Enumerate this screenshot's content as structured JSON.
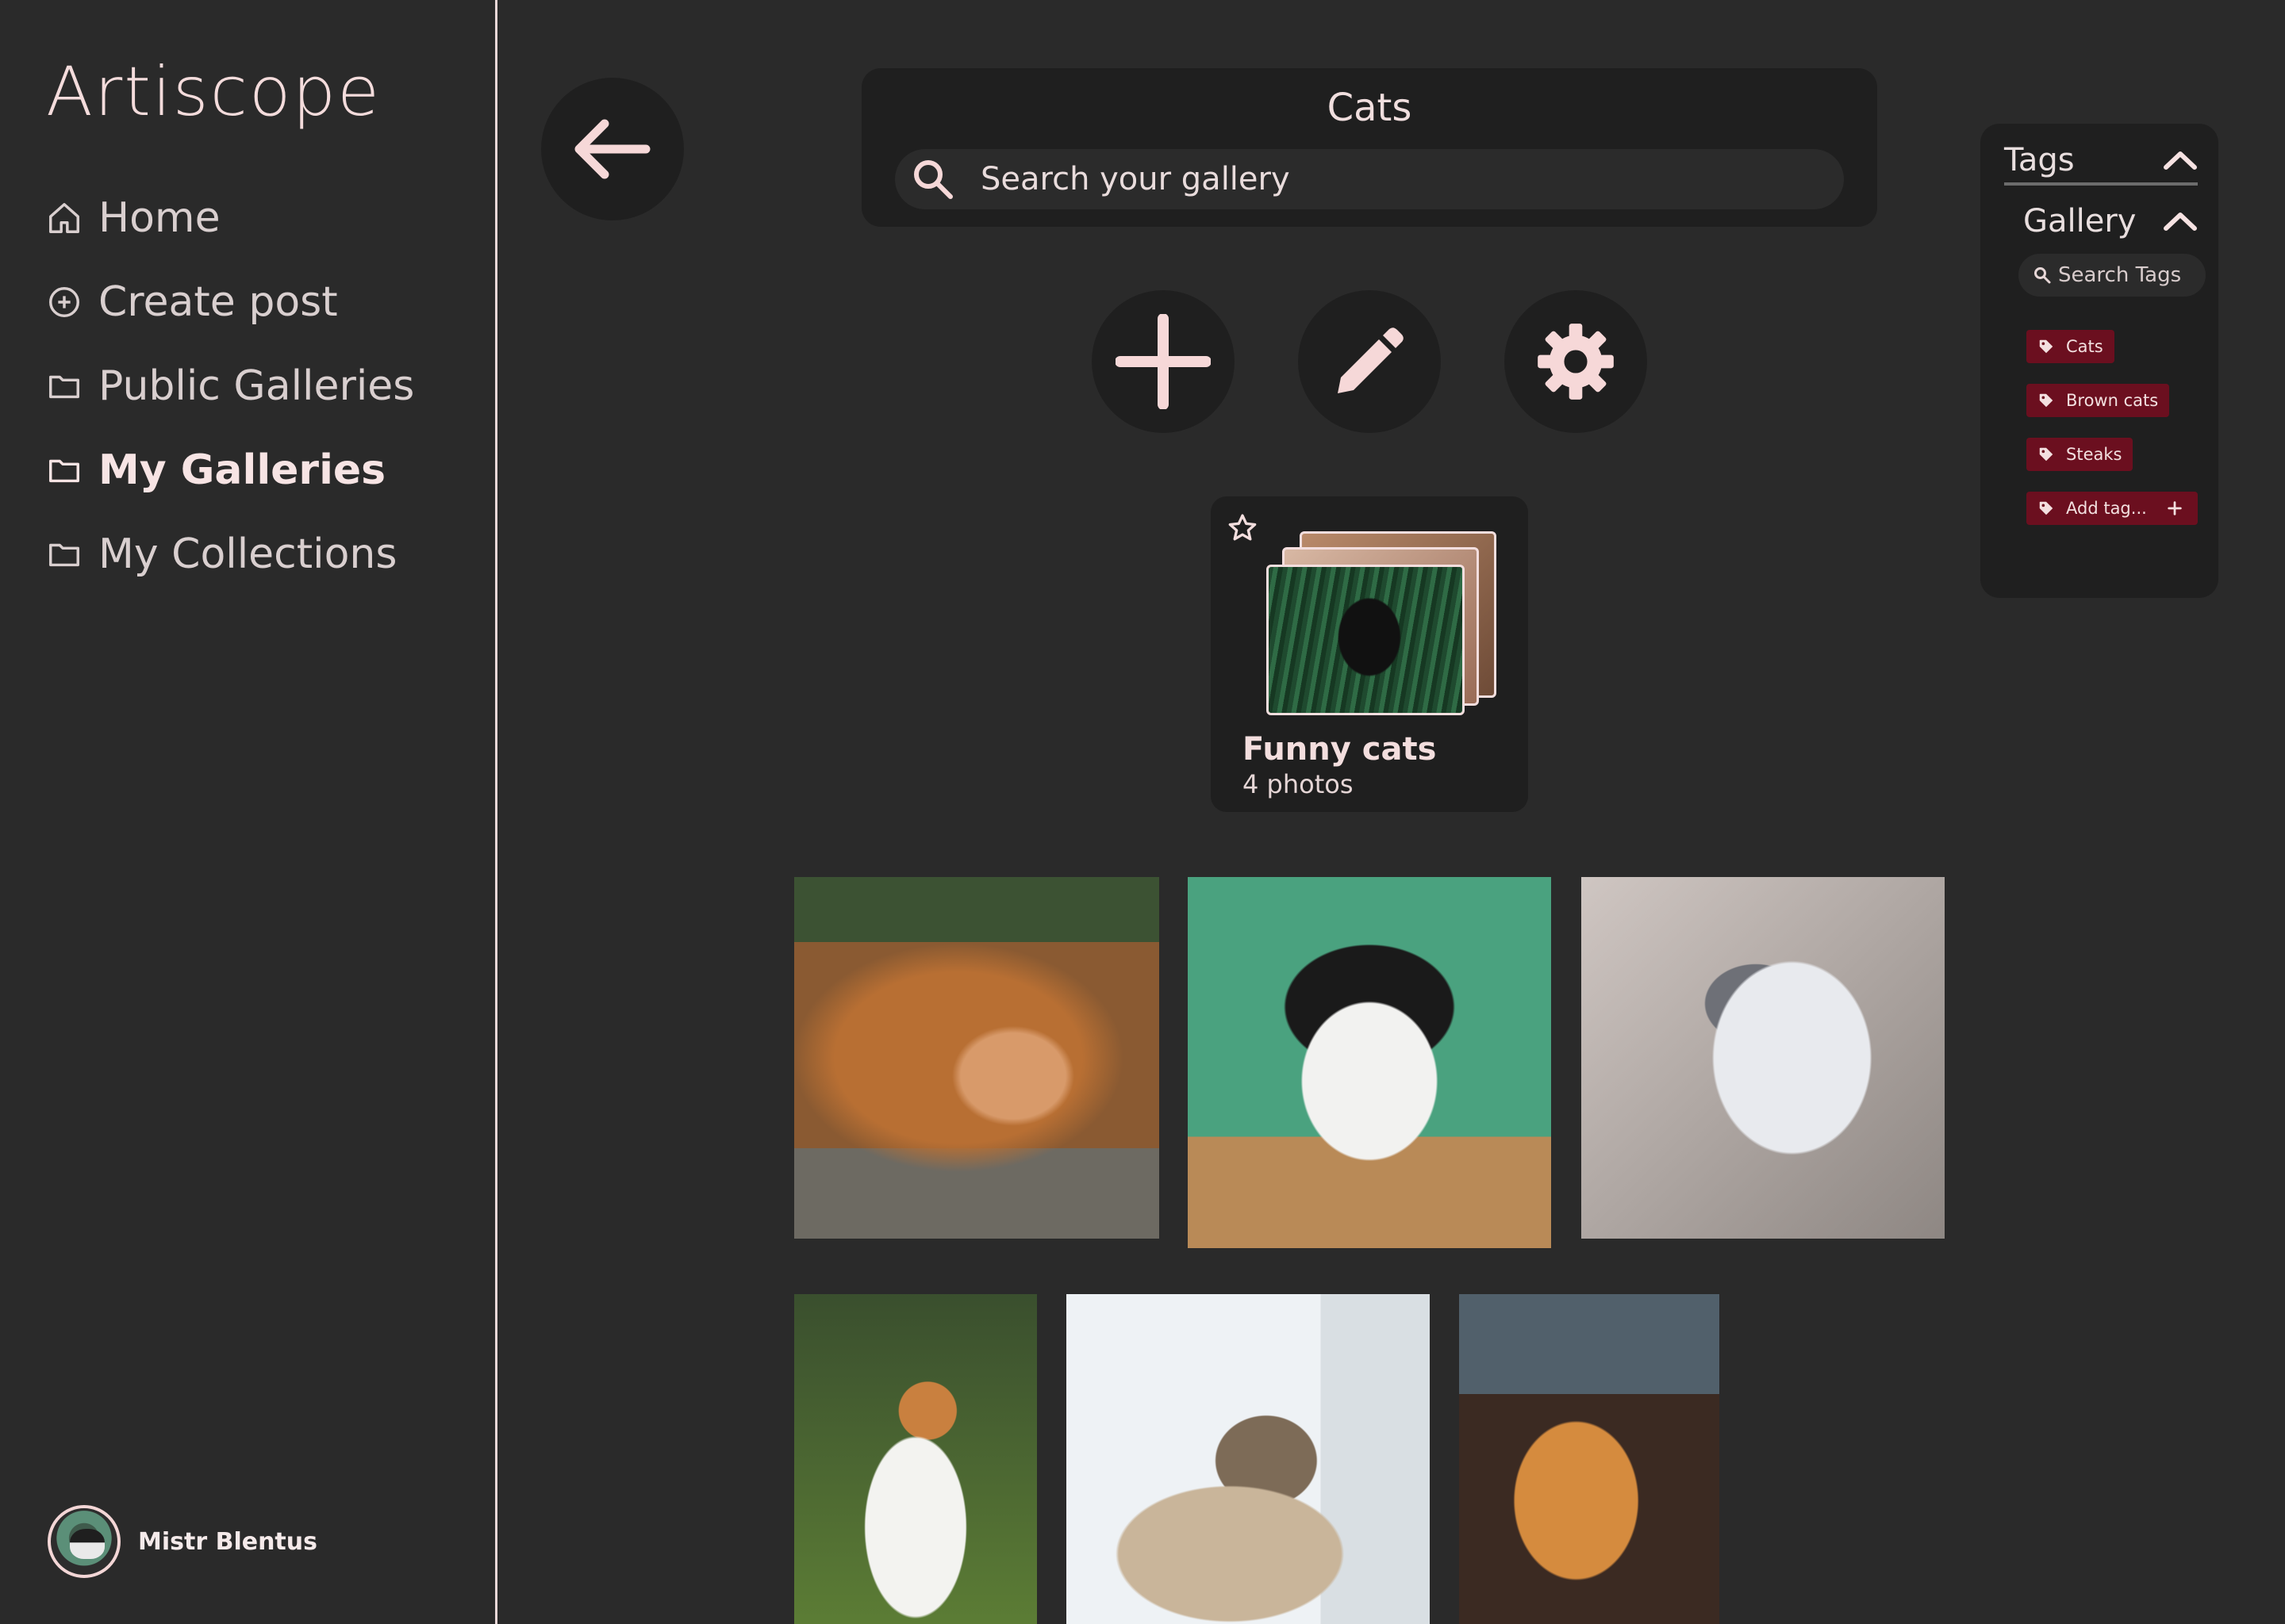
{
  "app": {
    "logo": "Artiscope"
  },
  "sidebar": {
    "items": [
      {
        "label": "Home",
        "icon": "home-icon",
        "active": false
      },
      {
        "label": "Create post",
        "icon": "plus-circle-icon",
        "active": false
      },
      {
        "label": "Public Galleries",
        "icon": "folder-icon",
        "active": false
      },
      {
        "label": "My Galleries",
        "icon": "folder-icon",
        "active": true
      },
      {
        "label": "My Collections",
        "icon": "folder-icon",
        "active": false
      }
    ],
    "user": {
      "name": "Mistr Blentus"
    }
  },
  "header": {
    "title": "Cats",
    "search_placeholder": "Search your gallery"
  },
  "actions": {
    "icons": [
      "back-arrow-icon",
      "plus-icon",
      "pencil-icon",
      "gear-icon"
    ]
  },
  "subgallery": {
    "title": "Funny cats",
    "count": "4 photos"
  },
  "tags_panel": {
    "title": "Tags",
    "section": "Gallery",
    "search_placeholder": "Search Tags",
    "tags": [
      "Cats",
      "Brown cats",
      "Steaks"
    ],
    "add_label": "Add tag..."
  },
  "colors": {
    "background": "#2a2a2a",
    "panel": "#1f1f1f",
    "accent": "#f7dada",
    "tag": "#6b0f1f"
  }
}
